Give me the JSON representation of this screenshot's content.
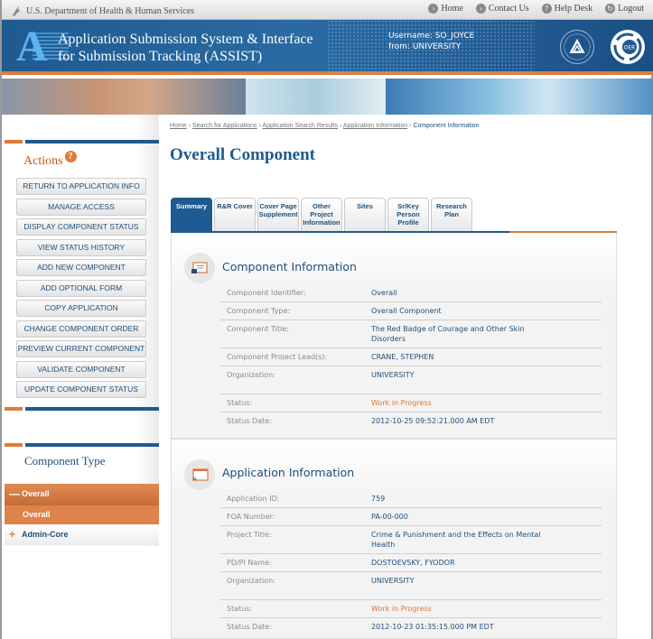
{
  "topbar": {
    "department": "U.S. Department of Health & Human Services",
    "links": [
      {
        "label": "Home",
        "icon": "home-icon"
      },
      {
        "label": "Contact Us",
        "icon": "contact-icon"
      },
      {
        "label": "Help Desk",
        "icon": "help-icon"
      },
      {
        "label": "Logout",
        "icon": "logout-icon"
      }
    ]
  },
  "header": {
    "logo_letter": "A",
    "title_line1": "Application Submission System & Interface",
    "title_line2": "for Submission Tracking (ASSIST)",
    "username_label": "Username:",
    "username": "SO_JOYCE",
    "from_label": "from:",
    "from": "UNIVERSITY",
    "oer_label": "OER"
  },
  "sidebar": {
    "actions_title": "Actions",
    "help_icon": "?",
    "actions": [
      "RETURN TO APPLICATION INFO",
      "MANAGE ACCESS",
      "DISPLAY COMPONENT STATUS",
      "VIEW STATUS HISTORY",
      "ADD NEW COMPONENT",
      "ADD OPTIONAL FORM",
      "COPY APPLICATION",
      "CHANGE COMPONENT ORDER",
      "PREVIEW CURRENT COMPONENT",
      "VALIDATE COMPONENT",
      "UPDATE COMPONENT STATUS"
    ],
    "component_type_title": "Component Type",
    "tree": [
      {
        "symbol": "—",
        "label": "Overall"
      },
      {
        "symbol": "",
        "label": "Overall"
      },
      {
        "symbol": "+",
        "label": "Admin-Core"
      }
    ]
  },
  "breadcrumb": {
    "items": [
      "Home",
      "Search for Applications",
      "Application Search Results",
      "Application Information"
    ],
    "current": "Component Information",
    "separator": "›"
  },
  "page_title": "Overall Component",
  "tabs": [
    {
      "label": "Summary",
      "active": true
    },
    {
      "label": "R&R Cover"
    },
    {
      "label": "Cover Page Supplement"
    },
    {
      "label": "Other Project Information"
    },
    {
      "label": "Sites"
    },
    {
      "label": "Sr/Key Person Profile"
    },
    {
      "label": "Research Plan"
    }
  ],
  "component_info": {
    "title": "Component Information",
    "fields": [
      {
        "label": "Component Identifier:",
        "value": "Overall"
      },
      {
        "label": "Component Type:",
        "value": "Overall Component"
      },
      {
        "label": "Component Title:",
        "value": "The Red Badge of Courage and Other Skin Disorders"
      },
      {
        "label": "Component Project Lead(s):",
        "value": "CRANE, STEPHEN"
      },
      {
        "label": "Organization:",
        "value": "UNIVERSITY"
      },
      {
        "label": "Status:",
        "value": "Work in Progress"
      },
      {
        "label": "Status Date:",
        "value": "2012-10-25 09:52:21.000 AM EDT"
      }
    ]
  },
  "application_info": {
    "title": "Application Information",
    "fields": [
      {
        "label": "Application ID:",
        "value": "759"
      },
      {
        "label": "FOA Number:",
        "value": "PA-00-000"
      },
      {
        "label": "Project Title:",
        "value": "Crime & Punishment and the Effects on Mental Health"
      },
      {
        "label": "PD/PI Name:",
        "value": "DOSTOEVSKY, FYODOR"
      },
      {
        "label": "Organization:",
        "value": "UNIVERSITY"
      },
      {
        "label": "Status:",
        "value": "Work in Progress"
      },
      {
        "label": "Status Date:",
        "value": "2012-10-23 01:35:15.000 PM EDT"
      }
    ]
  },
  "colors": {
    "brand_blue": "#1f5a90",
    "accent_orange": "#e07b3a",
    "status_orange": "#d9783a"
  }
}
